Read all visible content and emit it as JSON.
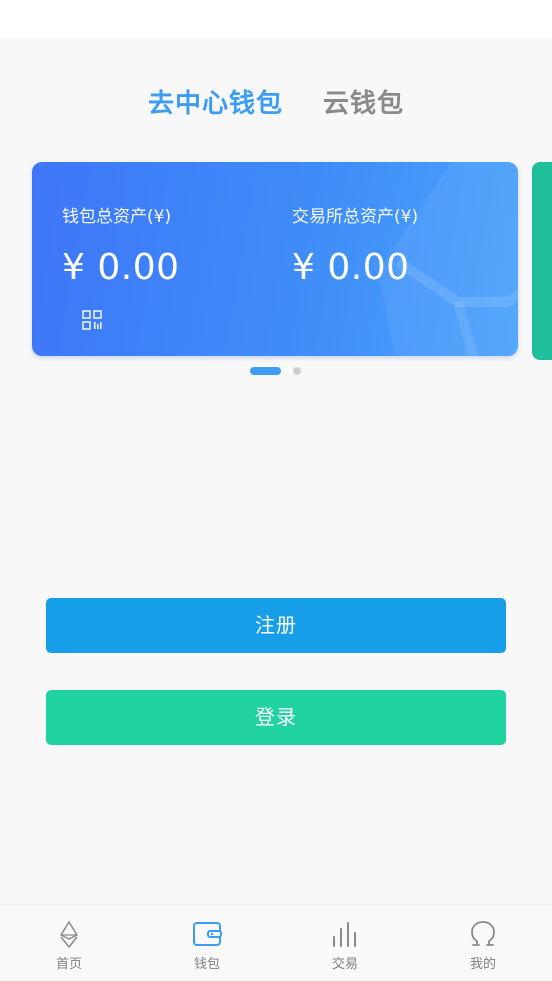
{
  "header": {
    "tabs": [
      {
        "label": "去中心钱包",
        "active": true
      },
      {
        "label": "云钱包",
        "active": false
      }
    ]
  },
  "wallet_card": {
    "wallet_total_label": "钱包总资产(¥)",
    "wallet_total_value": "¥ 0.00",
    "exchange_total_label": "交易所总资产(¥)",
    "exchange_total_value": "¥ 0.00",
    "qr_icon": "qr-code-icon"
  },
  "carousel": {
    "pages": 2,
    "current_page": 1
  },
  "actions": {
    "register_label": "注册",
    "login_label": "登录"
  },
  "tabbar": {
    "items": [
      {
        "label": "首页",
        "icon": "ethereum-icon"
      },
      {
        "label": "钱包",
        "icon": "wallet-icon"
      },
      {
        "label": "交易",
        "icon": "bar-chart-icon"
      },
      {
        "label": "我的",
        "icon": "omega-user-icon"
      }
    ],
    "active_index": 1
  },
  "colors": {
    "accent": "#3d9cf3",
    "register_button": "#169ee9",
    "login_button": "#20d3a1",
    "next_card": "#1fbf9b"
  }
}
